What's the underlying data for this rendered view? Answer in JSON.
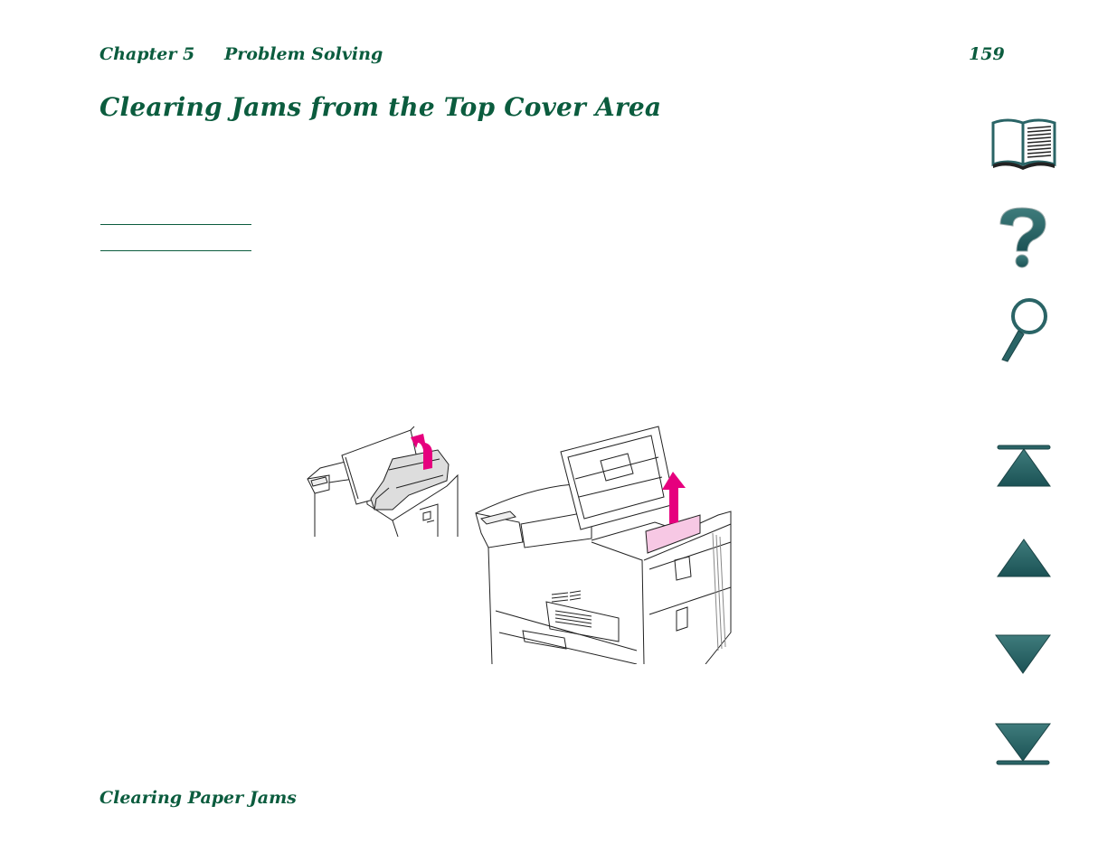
{
  "header": {
    "chapter": "Chapter 5",
    "section": "Problem Solving",
    "page_number": "159"
  },
  "title": "Clearing Jams from the Top Cover Area",
  "footer": {
    "section_title": "Clearing Paper Jams"
  },
  "nav": {
    "icons": [
      {
        "name": "contents-book-icon",
        "label": "Contents"
      },
      {
        "name": "help-question-icon",
        "label": "Help"
      },
      {
        "name": "search-magnifier-icon",
        "label": "Search"
      },
      {
        "name": "first-page-icon",
        "label": "First page"
      },
      {
        "name": "previous-page-icon",
        "label": "Previous page"
      },
      {
        "name": "next-page-icon",
        "label": "Next page"
      },
      {
        "name": "last-page-icon",
        "label": "Last page"
      }
    ]
  },
  "colors": {
    "text_green": "#0b5c3e",
    "icon_teal": "#2a6466",
    "arrow_magenta": "#e6007e",
    "paper_pink": "#f7c8e4"
  },
  "illustrations": [
    {
      "name": "remove-toner-cartridge-illustration"
    },
    {
      "name": "remove-jammed-paper-illustration"
    }
  ]
}
